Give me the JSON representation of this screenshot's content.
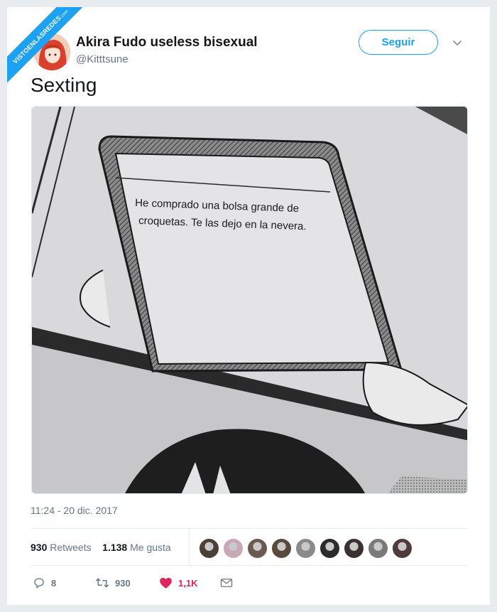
{
  "watermark": {
    "text": "VISTOENLASREDES",
    "suffix": ".com"
  },
  "author": {
    "name": "Akira Fudo useless bisexual",
    "handle": "@Kitttsune",
    "avatar_icon": "avatar-icon"
  },
  "follow_label": "Seguir",
  "tweet": {
    "text": "Sexting"
  },
  "media": {
    "description_lines": [
      "He comprado una bolsa grande de",
      "croquetas. Te las dejo en la nevera."
    ]
  },
  "timestamp": "11:24 - 20 dic. 2017",
  "stats": {
    "retweets_count": "930",
    "retweets_label": "Retweets",
    "likes_count": "1.138",
    "likes_label": "Me gusta"
  },
  "likers_colors": [
    "#4a4038",
    "#c7a8b4",
    "#6b5a4f",
    "#5a4a3e",
    "#8a8a8a",
    "#2b2b2b",
    "#3a3230",
    "#7a7a7a",
    "#4f3b3b"
  ],
  "actions": {
    "replies": "8",
    "retweets": "930",
    "likes": "1,1K"
  },
  "colors": {
    "accent": "#1da1f2",
    "like": "#e0245e",
    "muted": "#657786"
  }
}
